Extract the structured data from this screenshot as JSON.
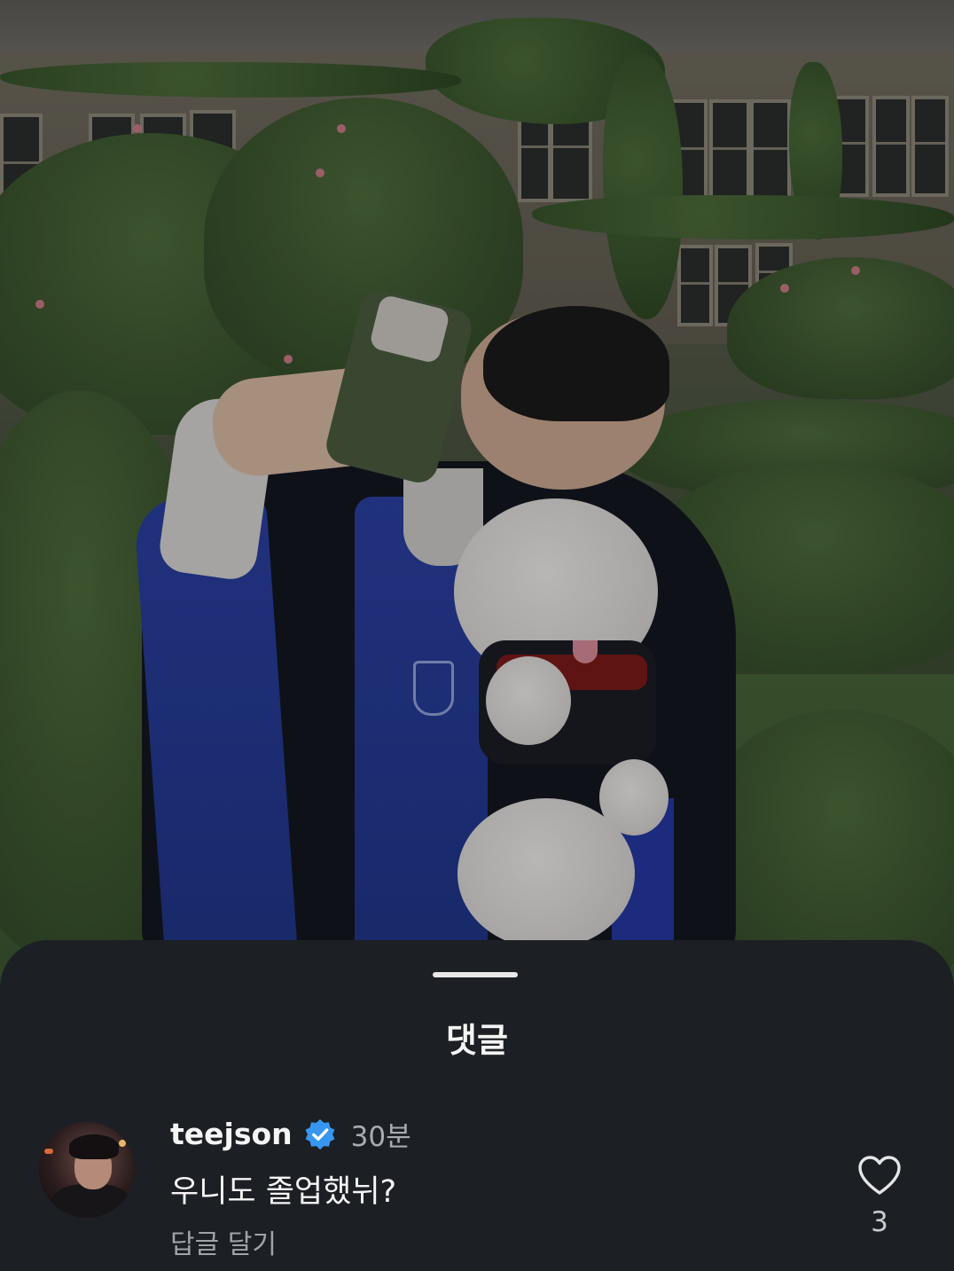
{
  "sheet": {
    "title": "댓글"
  },
  "comment": {
    "username": "teejson",
    "verified": true,
    "time": "30분",
    "text": "우니도 졸업했뉘?",
    "reply_label": "답글 달기",
    "like_count": "3",
    "avatar_icon": "user-avatar"
  },
  "colors": {
    "sheet_bg": "#1c1f23",
    "verified_blue": "#3797f0",
    "secondary_text": "#a8abb0"
  }
}
